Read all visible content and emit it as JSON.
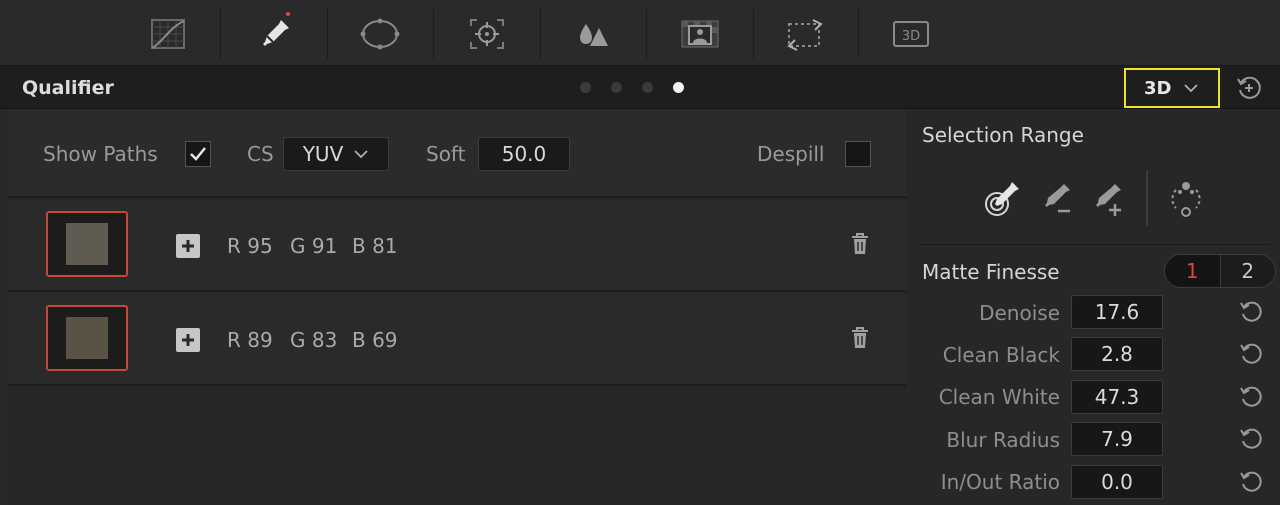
{
  "toolbar": {
    "tools": [
      {
        "name": "curves-icon"
      },
      {
        "name": "qualifier-eyedropper-icon",
        "active": true
      },
      {
        "name": "window-icon"
      },
      {
        "name": "tracker-icon"
      },
      {
        "name": "blur-icon"
      },
      {
        "name": "key-icon"
      },
      {
        "name": "sizing-icon"
      },
      {
        "name": "3d-icon",
        "label": "3D"
      }
    ]
  },
  "header": {
    "title": "Qualifier",
    "page_dots": 4,
    "active_dot": 4,
    "mode": "3D"
  },
  "controls": {
    "show_paths_label": "Show Paths",
    "show_paths_checked": true,
    "cs_label": "CS",
    "cs_value": "YUV",
    "soft_label": "Soft",
    "soft_value": "50.0",
    "despill_label": "Despill",
    "despill_checked": false
  },
  "swatches": [
    {
      "r": "R 95",
      "g": "G 91",
      "b": "B 81",
      "color": "#5f5b51"
    },
    {
      "r": "R 89",
      "g": "G 83",
      "b": "B 69",
      "color": "#595345"
    }
  ],
  "selection_range": {
    "title": "Selection Range"
  },
  "matte_finesse": {
    "title": "Matte Finesse",
    "tabs": [
      "1",
      "2"
    ],
    "active_tab": "1",
    "params": [
      {
        "label": "Denoise",
        "value": "17.6"
      },
      {
        "label": "Clean Black",
        "value": "2.8"
      },
      {
        "label": "Clean White",
        "value": "47.3"
      },
      {
        "label": "Blur Radius",
        "value": "7.9"
      },
      {
        "label": "In/Out Ratio",
        "value": "0.0"
      }
    ]
  },
  "colors": {
    "accent_yellow": "#f0e42a",
    "swatch_border": "#c24a3d",
    "active_tab": "#d9453a"
  }
}
